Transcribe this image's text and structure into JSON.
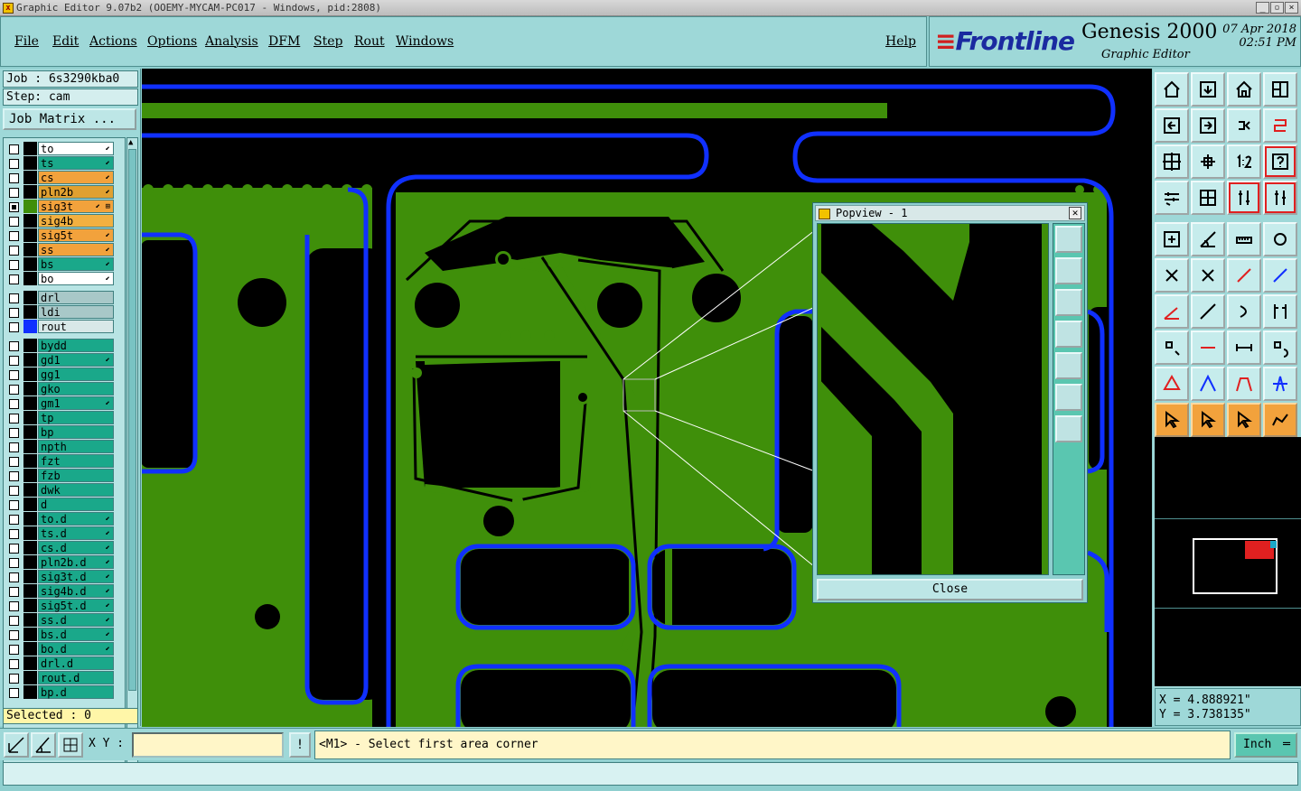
{
  "window": {
    "title": "Graphic Editor 9.07b2 (OOEMY-MYCAM-PC017 - Windows, pid:2808)"
  },
  "menu": {
    "items": [
      "File",
      "Edit",
      "Actions",
      "Options",
      "Analysis",
      "DFM",
      "Step",
      "Rout",
      "Windows"
    ],
    "help": "Help"
  },
  "brand": {
    "logo": "Frontline",
    "product": "Genesis 2000",
    "subtitle": "Graphic Editor",
    "date": "07 Apr 2018",
    "time": "02:51 PM"
  },
  "job": {
    "job_label": "Job : 6s3290kba0",
    "step_label": "Step: cam",
    "matrix_button": "Job Matrix ..."
  },
  "layers": {
    "board": [
      {
        "name": "to",
        "color": "#ffffff",
        "flag": "⬋"
      },
      {
        "name": "ts",
        "color": "#1aa88a",
        "flag": "⬋"
      },
      {
        "name": "cs",
        "color": "#f2a23c",
        "flag": "⬋"
      },
      {
        "name": "pln2b",
        "color": "#e0a030",
        "flag": "⬋"
      },
      {
        "name": "sig3t",
        "color": "#f2a23c",
        "flag": "⬋ ⊞",
        "active": true
      },
      {
        "name": "sig4b",
        "color": "#f2b040",
        "flag": ""
      },
      {
        "name": "sig5t",
        "color": "#f2a23c",
        "flag": "⬋"
      },
      {
        "name": "ss",
        "color": "#f2a23c",
        "flag": "⬋"
      },
      {
        "name": "bs",
        "color": "#1aa88a",
        "flag": "⬋"
      },
      {
        "name": "bo",
        "color": "#ffffff",
        "flag": "⬋"
      }
    ],
    "drill": [
      {
        "name": "drl",
        "color": "#a8c8c8",
        "flag": ""
      },
      {
        "name": "ldi",
        "color": "#a8c8c8",
        "flag": ""
      },
      {
        "name": "rout",
        "color": "#d8e8e8",
        "flag": "",
        "swatch": "#1030ff"
      }
    ],
    "misc": [
      {
        "name": "bydd",
        "flag": ""
      },
      {
        "name": "gd1",
        "flag": "⬋"
      },
      {
        "name": "gg1",
        "flag": ""
      },
      {
        "name": "gko",
        "flag": ""
      },
      {
        "name": "gm1",
        "flag": "⬋"
      },
      {
        "name": "tp",
        "flag": ""
      },
      {
        "name": "bp",
        "flag": ""
      },
      {
        "name": "npth",
        "flag": ""
      },
      {
        "name": "fzt",
        "flag": ""
      },
      {
        "name": "fzb",
        "flag": ""
      },
      {
        "name": "dwk",
        "flag": ""
      },
      {
        "name": "d",
        "flag": ""
      },
      {
        "name": "to.d",
        "flag": "⬋"
      },
      {
        "name": "ts.d",
        "flag": "⬋"
      },
      {
        "name": "cs.d",
        "flag": "⬋"
      },
      {
        "name": "pln2b.d",
        "flag": "⬋"
      },
      {
        "name": "sig3t.d",
        "flag": "⬋"
      },
      {
        "name": "sig4b.d",
        "flag": "⬋"
      },
      {
        "name": "sig5t.d",
        "flag": "⬋"
      },
      {
        "name": "ss.d",
        "flag": "⬋"
      },
      {
        "name": "bs.d",
        "flag": "⬋"
      },
      {
        "name": "bo.d",
        "flag": "⬋"
      },
      {
        "name": "drl.d",
        "flag": ""
      },
      {
        "name": "rout.d",
        "flag": ""
      },
      {
        "name": "bp.d",
        "flag": ""
      }
    ],
    "misc_color": "#1aa88a"
  },
  "selected": "Selected : 0",
  "popview": {
    "title": "Popview - 1",
    "close_label": "Close"
  },
  "coords": {
    "x": "X = 4.888921\"",
    "y": "Y = 3.738135\""
  },
  "bottom": {
    "xy_label": "X Y :",
    "xy_value": "",
    "bang": "!",
    "prompt": "<M1> - Select first area corner",
    "unit": "Inch"
  },
  "colors": {
    "copper": "#3f8f0a",
    "rout": "#1030ff",
    "panel": "#9ed8d8",
    "highlight_red": "#e02020"
  }
}
